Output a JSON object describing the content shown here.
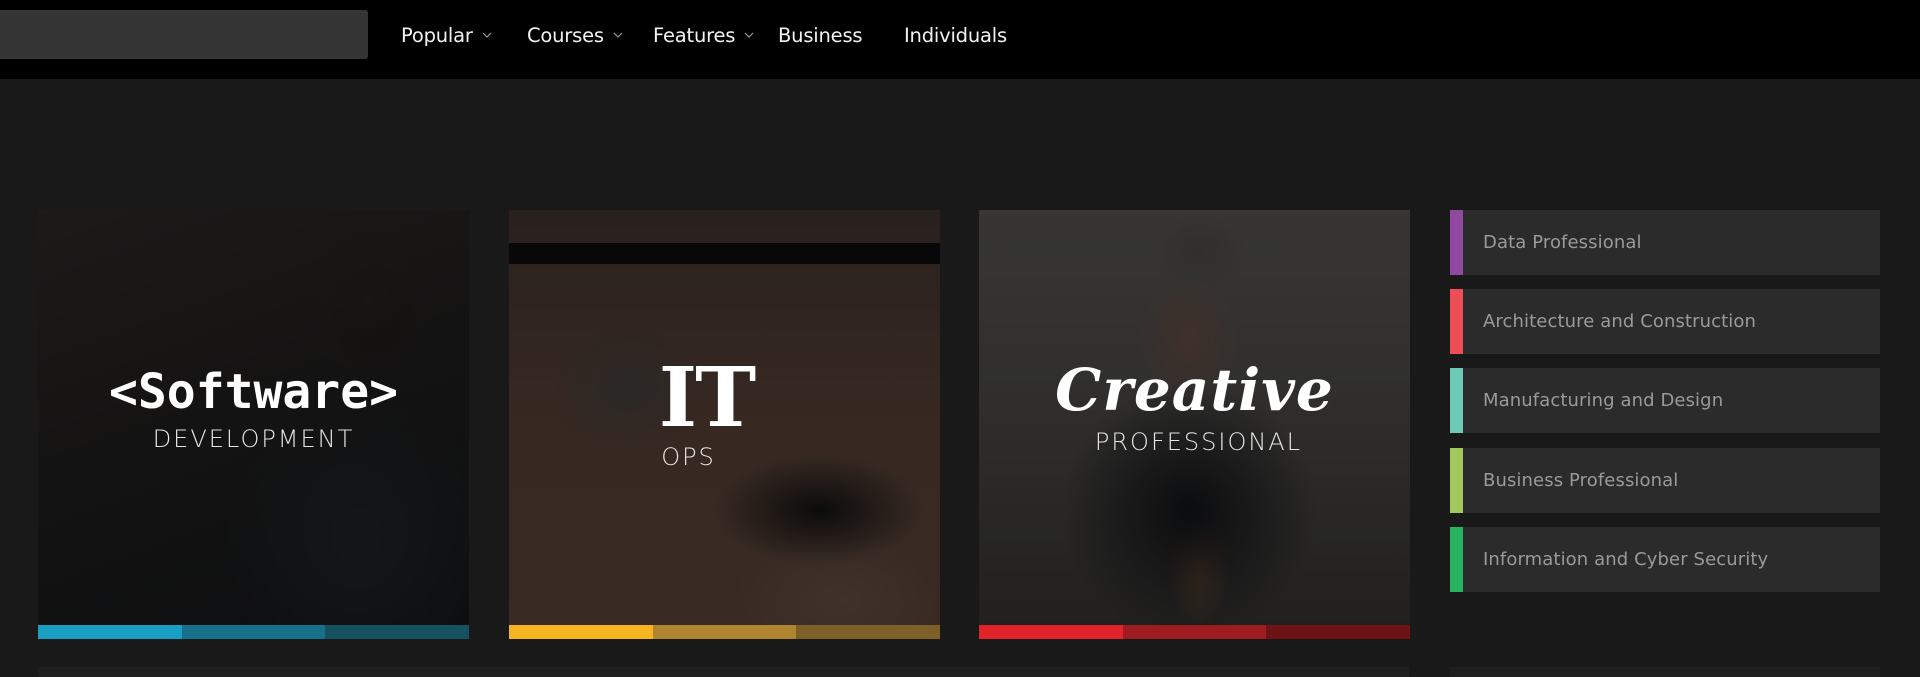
{
  "header": {
    "search": {
      "value": "",
      "placeholder": ""
    },
    "nav": [
      {
        "label": "Popular",
        "has_dropdown": true,
        "icon": "chevron-down-icon"
      },
      {
        "label": "Courses",
        "has_dropdown": true,
        "icon": "chevron-down-icon"
      },
      {
        "label": "Features",
        "has_dropdown": true,
        "icon": "chevron-down-icon"
      },
      {
        "label": "Business",
        "has_dropdown": false
      },
      {
        "label": "Individuals",
        "has_dropdown": false
      }
    ]
  },
  "cards": [
    {
      "title": "<Software>",
      "subtitle": "DEVELOPMENT",
      "bar_colors": [
        "#1a9fc4",
        "#17718a",
        "#15525f"
      ]
    },
    {
      "title": "IT",
      "subtitle": "OPS",
      "bar_colors": [
        "#f7b421",
        "#b08530",
        "#7c6027"
      ]
    },
    {
      "title": "Creative",
      "subtitle": "PROFESSIONAL",
      "bar_colors": [
        "#df2328",
        "#9c1c20",
        "#6d1316"
      ]
    }
  ],
  "roles": [
    {
      "label": "Data Professional",
      "color": "#8f4aa0"
    },
    {
      "label": "Architecture and Construction",
      "color": "#ee4f57"
    },
    {
      "label": "Manufacturing and Design",
      "color": "#6ccab7"
    },
    {
      "label": "Business Professional",
      "color": "#a1ca5a"
    },
    {
      "label": "Information and Cyber Security",
      "color": "#27b461"
    }
  ]
}
